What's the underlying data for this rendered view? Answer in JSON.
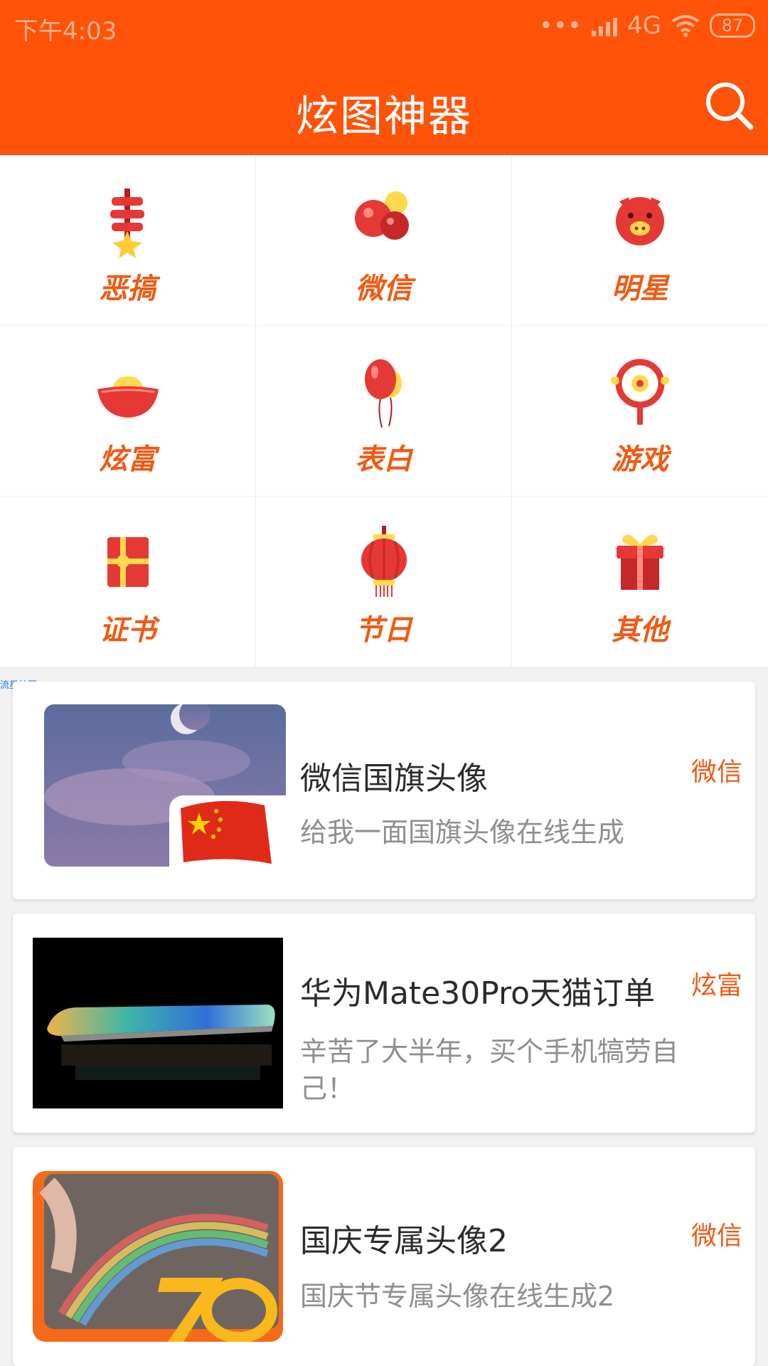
{
  "status_bar": {
    "time": "下午4:03",
    "network": "4G",
    "battery": "87"
  },
  "header": {
    "title": "炫图神器"
  },
  "categories": [
    {
      "label": "恶搞",
      "icon": "firecracker-icon"
    },
    {
      "label": "微信",
      "icon": "chat-bubbles-icon"
    },
    {
      "label": "明星",
      "icon": "pig-icon"
    },
    {
      "label": "炫富",
      "icon": "gold-ingot-icon"
    },
    {
      "label": "表白",
      "icon": "balloon-icon"
    },
    {
      "label": "游戏",
      "icon": "target-icon"
    },
    {
      "label": "证书",
      "icon": "red-envelope-icon"
    },
    {
      "label": "节日",
      "icon": "lantern-icon"
    },
    {
      "label": "其他",
      "icon": "gift-box-icon"
    }
  ],
  "tiny_label": "流星社区",
  "cards": [
    {
      "title": "微信国旗头像",
      "desc": "给我一面国旗头像在线生成",
      "tag": "微信"
    },
    {
      "title": "华为Mate30Pro天猫订单",
      "desc": "辛苦了大半年，买个手机犒劳自己！",
      "tag": "炫富"
    },
    {
      "title": "国庆专属头像2",
      "desc": "国庆节专属头像在线生成2",
      "tag": "微信"
    }
  ],
  "colors": {
    "brand": "#fe5309",
    "accent_text": "#f05a14"
  }
}
